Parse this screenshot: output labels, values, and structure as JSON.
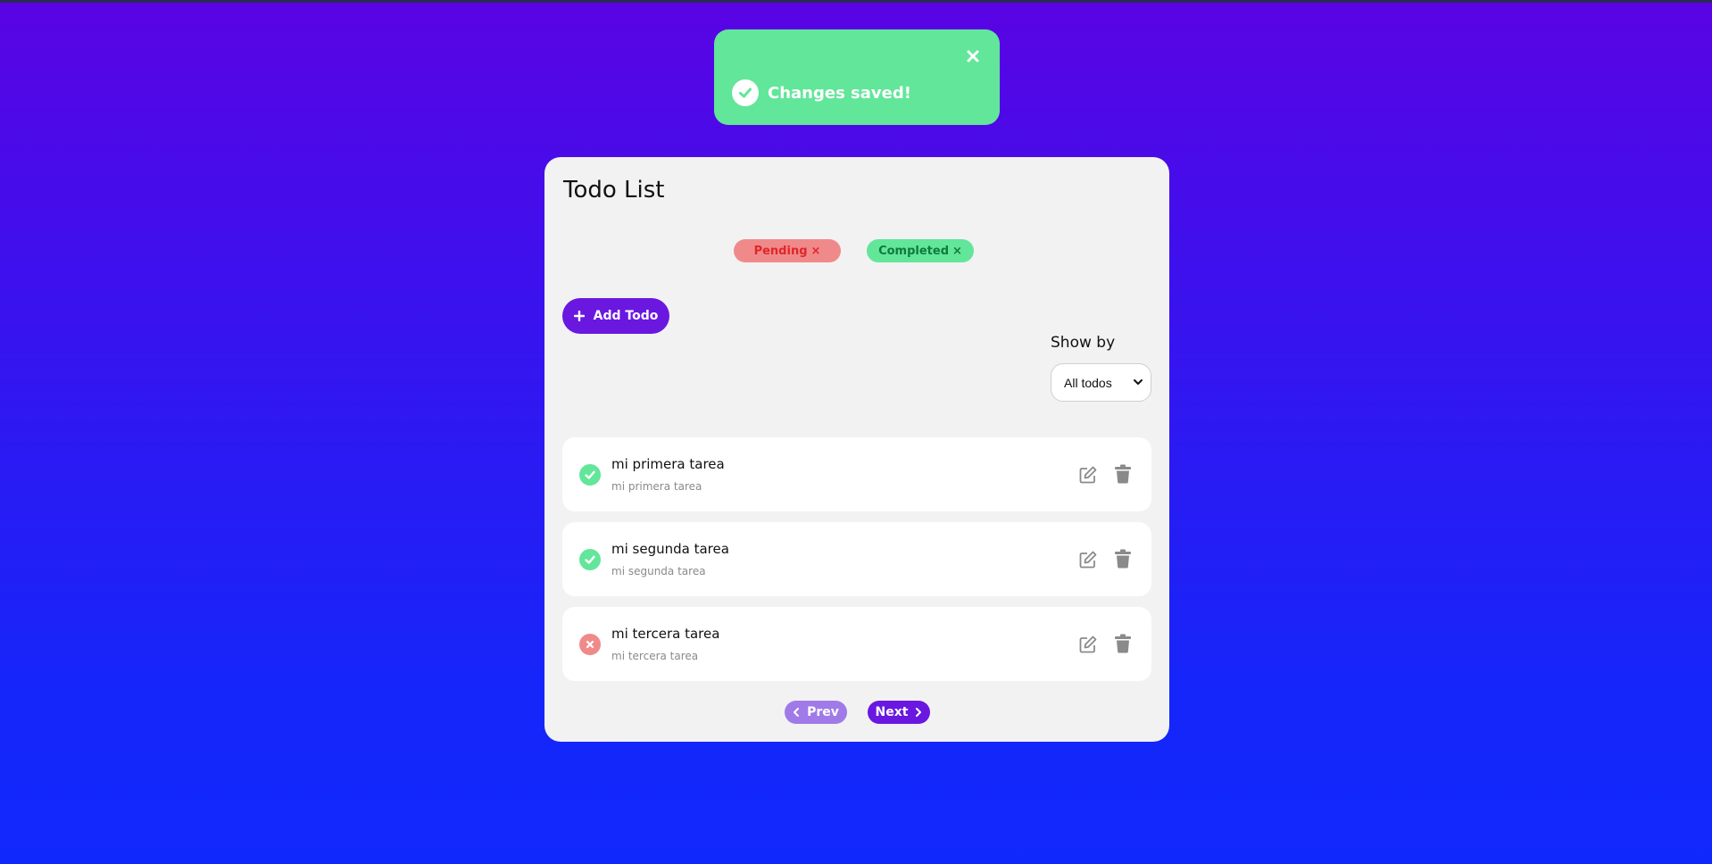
{
  "toast": {
    "message": "Changes saved!",
    "color": "#62e69a"
  },
  "card": {
    "title": "Todo List"
  },
  "filters": {
    "pending_label": "Pending",
    "completed_label": "Completed",
    "remove_glyph": "×"
  },
  "actions": {
    "add_label": "Add Todo"
  },
  "show_by": {
    "label": "Show by",
    "selected": "All todos"
  },
  "todos": [
    {
      "title": "mi primera tarea",
      "description": "mi primera tarea",
      "status": "completed"
    },
    {
      "title": "mi segunda tarea",
      "description": "mi segunda tarea",
      "status": "completed"
    },
    {
      "title": "mi tercera tarea",
      "description": "mi tercera tarea",
      "status": "pending"
    }
  ],
  "pagination": {
    "prev_label": "Prev",
    "next_label": "Next"
  },
  "colors": {
    "accent": "#6a18e0",
    "completed": "#62e69a",
    "pending": "#f08a8a"
  }
}
